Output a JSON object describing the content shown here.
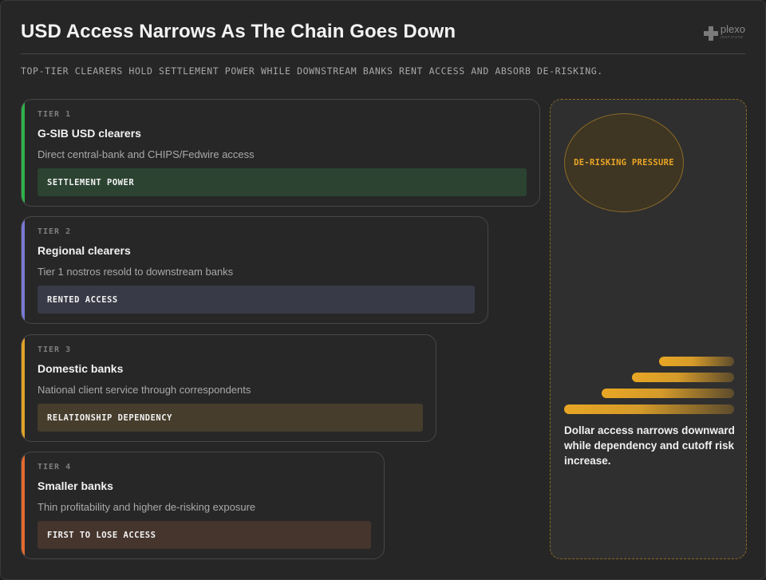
{
  "header": {
    "title": "USD Access Narrows As The Chain Goes Down",
    "subtitle": "TOP-TIER CLEARERS HOLD SETTLEMENT POWER WHILE DOWNSTREAM BANKS RENT ACCESS AND ABSORB DE-RISKING.",
    "logo": {
      "name": "plexo",
      "sub": "INSTITUTE",
      "icon": "plus-cross-icon"
    }
  },
  "tiers": [
    {
      "label": "TIER 1",
      "name": "G-SIB USD clearers",
      "desc": "Direct central-bank and CHIPS/Fedwire access",
      "bar": "SETTLEMENT POWER",
      "accent": "#2fb24a",
      "bar_color": "#2c4332"
    },
    {
      "label": "TIER 2",
      "name": "Regional clearers",
      "desc": "Tier 1 nostros resold to downstream banks",
      "bar": "RENTED ACCESS",
      "accent": "#7a79d6",
      "bar_color": "#393a47"
    },
    {
      "label": "TIER 3",
      "name": "Domestic banks",
      "desc": "National client service through correspondents",
      "bar": "RELATIONSHIP DEPENDENCY",
      "accent": "#e0a328",
      "bar_color": "#463d2c"
    },
    {
      "label": "TIER 4",
      "name": "Smaller banks",
      "desc": "Thin profitability and higher de-risking exposure",
      "bar": "FIRST TO LOSE ACCESS",
      "accent": "#e56a2e",
      "bar_color": "#45352d"
    }
  ],
  "side_panel": {
    "pressure_label": "DE-RISKING PRESSURE",
    "summary": "Dollar access narrows downward while dependency and cutoff risk increase.",
    "accent": "#e8a624"
  }
}
